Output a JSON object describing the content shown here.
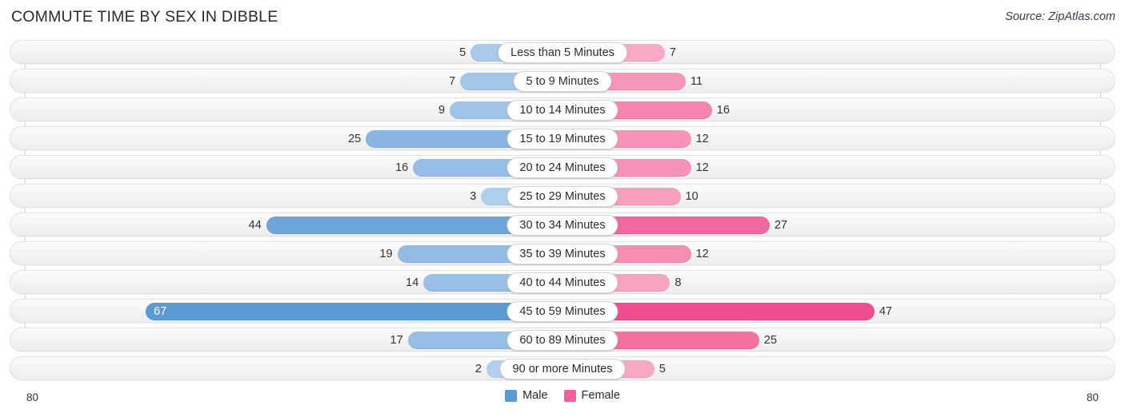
{
  "header": {
    "title": "COMMUTE TIME BY SEX IN DIBBLE",
    "source": "Source: ZipAtlas.com"
  },
  "axis": {
    "left_label": "80",
    "right_label": "80",
    "max": 80
  },
  "legend": {
    "items": [
      {
        "label": "Male",
        "color": "#5b9bd5"
      },
      {
        "label": "Female",
        "color": "#f0609b"
      }
    ]
  },
  "colors": {
    "male_strong": "#5b9bd5",
    "male_mid": "#8db8e4",
    "male_light": "#aecdec",
    "female_strong": "#f0609b",
    "female_mid": "#f589b2",
    "female_light": "#f8a8c4",
    "track": "#f4f4f4",
    "gridline": "#d7d7d7"
  },
  "chart_data": {
    "type": "bar",
    "orientation": "horizontal-diverging",
    "title": "COMMUTE TIME BY SEX IN DIBBLE",
    "xlabel": "",
    "ylabel": "",
    "xlim": [
      -80,
      80
    ],
    "grid": true,
    "legend_position": "bottom-center",
    "categories": [
      "Less than 5 Minutes",
      "5 to 9 Minutes",
      "10 to 14 Minutes",
      "15 to 19 Minutes",
      "20 to 24 Minutes",
      "25 to 29 Minutes",
      "30 to 34 Minutes",
      "35 to 39 Minutes",
      "40 to 44 Minutes",
      "45 to 59 Minutes",
      "60 to 89 Minutes",
      "90 or more Minutes"
    ],
    "series": [
      {
        "name": "Male",
        "values": [
          5,
          7,
          9,
          25,
          16,
          3,
          44,
          19,
          14,
          67,
          17,
          2
        ]
      },
      {
        "name": "Female",
        "values": [
          7,
          11,
          16,
          12,
          12,
          10,
          27,
          12,
          8,
          47,
          25,
          5
        ]
      }
    ]
  },
  "rows": [
    {
      "label": "Less than 5 Minutes",
      "male": 5,
      "female": 7,
      "male_color": "#a9caeb",
      "female_color": "#f8a9c5",
      "male_inside": false,
      "female_inside": false
    },
    {
      "label": "5 to 9 Minutes",
      "male": 7,
      "female": 11,
      "male_color": "#a4c6e9",
      "female_color": "#f596ba",
      "male_inside": false,
      "female_inside": false
    },
    {
      "label": "10 to 14 Minutes",
      "male": 9,
      "female": 16,
      "male_color": "#a0c4e8",
      "female_color": "#f584ae",
      "male_inside": false,
      "female_inside": false
    },
    {
      "label": "15 to 19 Minutes",
      "male": 25,
      "female": 12,
      "male_color": "#89b6e2",
      "female_color": "#f593b8",
      "male_inside": false,
      "female_inside": false
    },
    {
      "label": "20 to 24 Minutes",
      "male": 16,
      "female": 12,
      "male_color": "#95bde5",
      "female_color": "#f593b8",
      "male_inside": false,
      "female_inside": false
    },
    {
      "label": "25 to 29 Minutes",
      "male": 3,
      "female": 10,
      "male_color": "#afcfee",
      "female_color": "#f89ebe",
      "male_inside": false,
      "female_inside": false
    },
    {
      "label": "30 to 34 Minutes",
      "male": 44,
      "female": 27,
      "male_color": "#6ea6d9",
      "female_color": "#f1679f",
      "male_inside": false,
      "female_inside": false
    },
    {
      "label": "35 to 39 Minutes",
      "male": 19,
      "female": 12,
      "male_color": "#92bbe4",
      "female_color": "#f68eb4",
      "male_inside": false,
      "female_inside": false
    },
    {
      "label": "40 to 44 Minutes",
      "male": 14,
      "female": 8,
      "male_color": "#99bfe6",
      "female_color": "#f8a3c1",
      "male_inside": false,
      "female_inside": false
    },
    {
      "label": "45 to 59 Minutes",
      "male": 67,
      "female": 47,
      "male_color": "#5b9bd5",
      "female_color": "#ee4e90",
      "male_inside": true,
      "female_inside": false
    },
    {
      "label": "60 to 89 Minutes",
      "male": 17,
      "female": 25,
      "male_color": "#95bde5",
      "female_color": "#f3709f",
      "male_inside": false,
      "female_inside": false
    },
    {
      "label": "90 or more Minutes",
      "male": 2,
      "female": 5,
      "male_color": "#b2d0ee",
      "female_color": "#f8a8c4",
      "male_inside": false,
      "female_inside": false
    }
  ]
}
